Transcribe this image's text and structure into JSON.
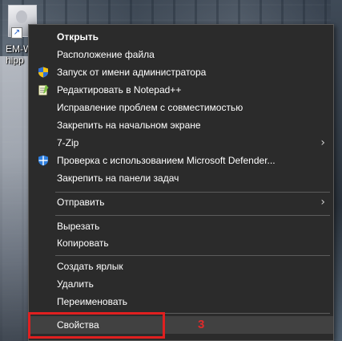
{
  "desktop": {
    "icon_label_line1": "EM-W",
    "icon_label_line2": "hipp"
  },
  "menu": {
    "items": [
      {
        "label": "Открыть",
        "icon": null
      },
      {
        "label": "Расположение файла",
        "icon": null
      },
      {
        "label": "Запуск от имени администратора",
        "icon": "uac-shield-icon"
      },
      {
        "label": "Редактировать в Notepad++",
        "icon": "notepadpp-icon"
      },
      {
        "label": "Исправление проблем с совместимостью",
        "icon": null
      },
      {
        "label": "Закрепить на начальном экране",
        "icon": null
      },
      {
        "label": "7-Zip",
        "icon": null,
        "submenu": true
      },
      {
        "label": "Проверка с использованием Microsoft Defender...",
        "icon": "defender-icon"
      },
      {
        "label": "Закрепить на панели задач",
        "icon": null
      },
      {
        "label": "Отправить",
        "icon": null,
        "submenu": true
      },
      {
        "label": "Вырезать",
        "icon": null
      },
      {
        "label": "Копировать",
        "icon": null
      },
      {
        "label": "Создать ярлык",
        "icon": null
      },
      {
        "label": "Удалить",
        "icon": null
      },
      {
        "label": "Переименовать",
        "icon": null
      },
      {
        "label": "Свойства",
        "icon": null
      }
    ],
    "submenu_arrow": "›"
  },
  "annotation": {
    "number": "3",
    "color": "#e02020"
  },
  "colors": {
    "menu_background": "#2b2b2b",
    "menu_text": "#ffffff",
    "hover_background": "#414141",
    "separator": "#5c5c5c"
  }
}
